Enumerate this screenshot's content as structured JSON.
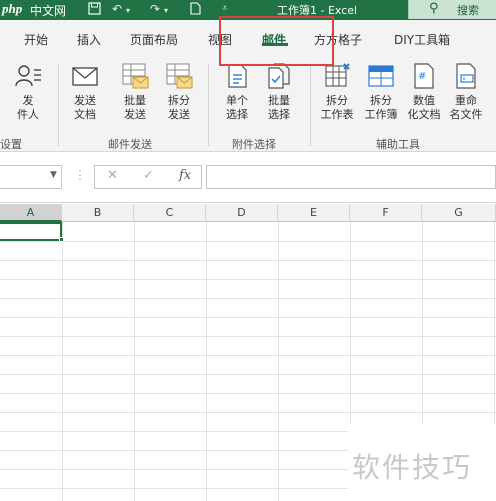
{
  "titlebar": {
    "logo": "php",
    "logo_sub": "中文网",
    "window_title": "工作簿1 - Excel",
    "search_label": "搜索"
  },
  "tabs": [
    {
      "label": "开始"
    },
    {
      "label": "插入"
    },
    {
      "label": "页面布局"
    },
    {
      "label": "视图"
    },
    {
      "label": "邮件",
      "active": true
    },
    {
      "label": "方方格子"
    },
    {
      "label": "DIY工具箱"
    }
  ],
  "ribbon": {
    "buttons": [
      {
        "label": "发\n件人",
        "icon": "sender-icon"
      },
      {
        "label": "发送\n文档",
        "icon": "envelope-icon"
      },
      {
        "label": "批量\n发送",
        "icon": "batch-send-icon"
      },
      {
        "label": "拆分\n发送",
        "icon": "split-send-icon"
      },
      {
        "label": "单个\n选择",
        "icon": "single-select-icon"
      },
      {
        "label": "批量\n选择",
        "icon": "batch-select-icon"
      },
      {
        "label": "拆分\n工作表",
        "icon": "split-sheet-icon"
      },
      {
        "label": "拆分\n工作簿",
        "icon": "split-workbook-icon"
      },
      {
        "label": "数值\n化文档",
        "icon": "numeric-doc-icon"
      },
      {
        "label": "重命\n名文件",
        "icon": "rename-file-icon"
      }
    ],
    "groups": [
      {
        "label": "设置"
      },
      {
        "label": "邮件发送"
      },
      {
        "label": "附件选择"
      },
      {
        "label": "辅助工具"
      }
    ]
  },
  "formula_bar": {
    "name_box_value": "",
    "cancel_symbol": "✕",
    "enter_symbol": "✓",
    "fx_label": "fx",
    "formula_value": ""
  },
  "grid": {
    "columns": [
      "A",
      "B",
      "C",
      "D",
      "E",
      "F",
      "G"
    ],
    "selected_column": "A"
  },
  "watermark": {
    "text": "软件技巧"
  },
  "colors": {
    "accent": "#217346",
    "highlight": "#e04040"
  }
}
